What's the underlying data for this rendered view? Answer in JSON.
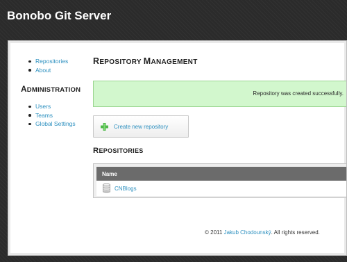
{
  "header": {
    "title": "Bonobo Git Server"
  },
  "sidebar": {
    "nav": [
      {
        "label": "Repositories"
      },
      {
        "label": "About"
      }
    ],
    "admin_heading": {
      "first": "A",
      "rest": "DMINISTRATION"
    },
    "admin_nav": [
      {
        "label": "Users"
      },
      {
        "label": "Teams"
      },
      {
        "label": "Global Settings"
      }
    ]
  },
  "main": {
    "title": {
      "w1_first": "R",
      "w1_rest": "EPOSITORY",
      "w2_first": "M",
      "w2_rest": "ANAGEMENT"
    },
    "success_message": "Repository was created successfully.",
    "create_button_label": "Create new repository",
    "section_title": {
      "first": "R",
      "rest": "EPOSITORIES"
    },
    "table": {
      "columns": [
        "Name"
      ],
      "rows": [
        {
          "name": "CNBlogs"
        }
      ]
    }
  },
  "footer": {
    "prefix": "© 2011",
    "author": "Jakub Chodounský",
    "suffix": ". All rights reserved."
  },
  "colors": {
    "link": "#2b8fbf",
    "success_bg": "#d2f7cd",
    "header_bg": "#2b2b2b",
    "table_header_bg": "#6b6b6b"
  },
  "icons": {
    "create": "plus-icon",
    "repository": "database-icon"
  }
}
